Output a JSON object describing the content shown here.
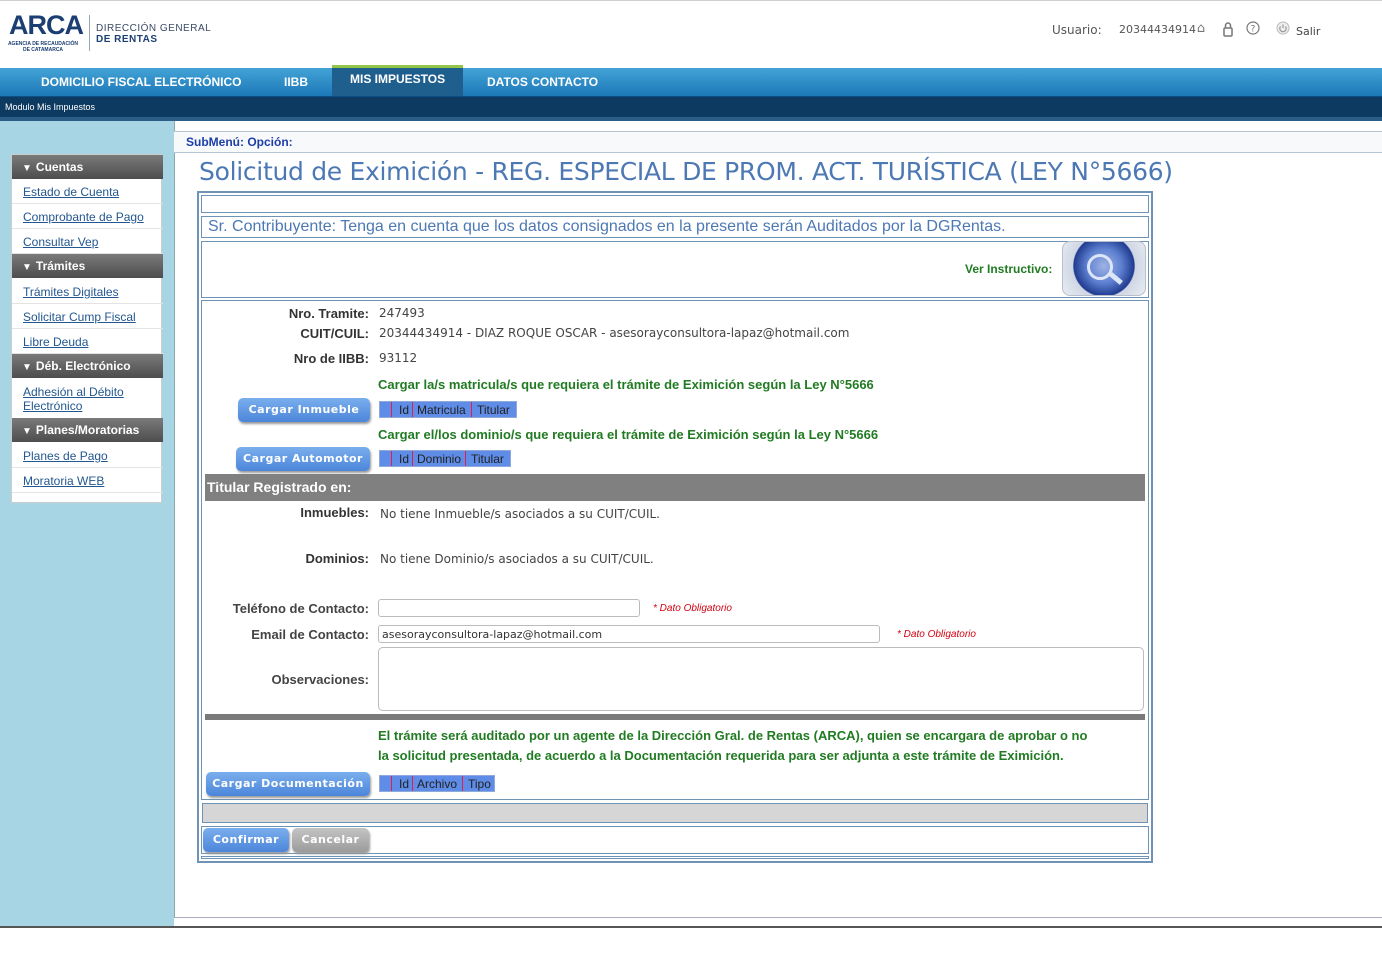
{
  "header": {
    "logo_text": "ARCA",
    "logo_subtitle": "AGENCIA DE RECAUDACIÓN DE CATAMARCA",
    "org_line1": "DIRECCIÓN GENERAL",
    "org_line2": "DE RENTAS",
    "user_label": "Usuario:",
    "user_value": "20344434914",
    "logout_label": "Salir",
    "icons": [
      "home-icon",
      "lock-icon",
      "help-icon",
      "power-icon"
    ]
  },
  "nav": {
    "tabs": [
      {
        "label": "DOMICILIO FISCAL ELECTRÓNICO"
      },
      {
        "label": "IIBB"
      },
      {
        "label": "MIS IMPUESTOS"
      },
      {
        "label": "DATOS CONTACTO"
      }
    ],
    "active_tab": "MIS IMPUESTOS",
    "module_label": "Modulo Mis Impuestos"
  },
  "sidebar": {
    "sections": [
      {
        "title": "Cuentas",
        "items": [
          "Estado de Cuenta",
          "Comprobante de Pago",
          "Consultar Vep"
        ]
      },
      {
        "title": "Trámites",
        "items": [
          "Trámites Digitales",
          "Solicitar Cump Fiscal",
          "Libre Deuda"
        ]
      },
      {
        "title": "Déb. Electrónico",
        "items": [
          "Adhesión al Débito Electrónico"
        ]
      },
      {
        "title": "Planes/Moratorias",
        "items": [
          "Planes de Pago",
          "Moratoria WEB"
        ]
      }
    ]
  },
  "main": {
    "submenu_label": "SubMenú: Opción:",
    "title": "Solicitud de Eximición - REG. ESPECIAL DE PROM. ACT. TURÍSTICA (LEY N°5666)",
    "notice": "Sr. Contribuyente: Tenga en cuenta que los datos consignados en la presente serán Auditados por la DGRentas.",
    "instructivo_label": "Ver Instructivo:",
    "fields": {
      "nro_tramite_label": "Nro. Tramite:",
      "nro_tramite_value": "247493",
      "cuit_label": "CUIT/CUIL:",
      "cuit_value": "20344434914 - DIAZ ROQUE OSCAR - asesorayconsultora-lapaz@hotmail.com",
      "iibb_label": "Nro de IIBB:",
      "iibb_value": "93112"
    },
    "inmueble_hint": "Cargar la/s matricula/s que requiera el trámite de Eximición según la Ley N°5666",
    "inmueble_button": "Cargar  Inmueble",
    "inmueble_grid": [
      "Id",
      "Matricula",
      "Titular"
    ],
    "automotor_hint": "Cargar el/los dominio/s que requiera el trámite de Eximición según la Ley N°5666",
    "automotor_button": "Cargar Automotor",
    "automotor_grid": [
      "Id",
      "Dominio",
      "Titular"
    ],
    "titular_section": "Titular Registrado en:",
    "inmuebles_label": "Inmuebles:",
    "inmuebles_value": "No tiene Inmueble/s asociados a su CUIT/CUIL.",
    "dominios_label": "Dominios:",
    "dominios_value": "No tiene Dominio/s asociados a su CUIT/CUIL.",
    "telefono_label": "Teléfono de Contacto:",
    "telefono_value": "",
    "email_label": "Email de Contacto:",
    "email_value": "asesorayconsultora-lapaz@hotmail.com",
    "required_note": "* Dato Obligatorio",
    "observaciones_label": "Observaciones:",
    "observaciones_value": "",
    "audit_line1": "El trámite será auditado por un agente de la Dirección Gral. de Rentas (ARCA), quien se encargara de aprobar o no",
    "audit_line2": "la solicitud presentada, de acuerdo a la Documentación requerida para ser adjunta a este trámite de Eximición.",
    "doc_button": "Cargar Documentación",
    "doc_grid": [
      "Id",
      "Archivo",
      "Tipo"
    ],
    "confirm_button": "Confirmar",
    "cancel_button": "Cancelar"
  }
}
